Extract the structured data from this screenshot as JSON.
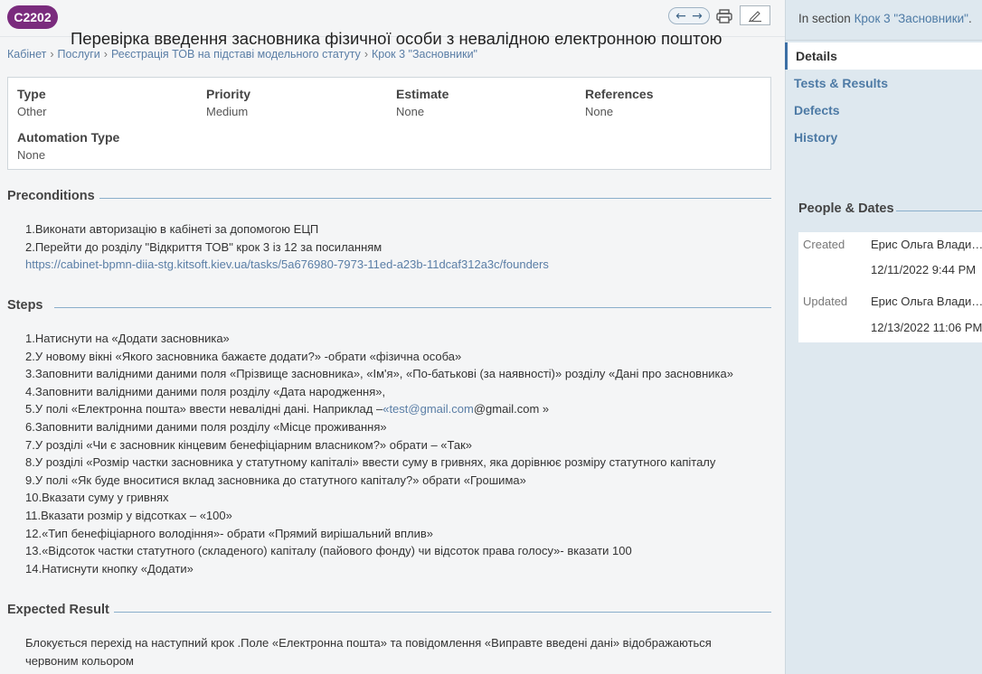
{
  "case": {
    "id": "C2202",
    "title": "Перевірка введення засновника фізичної особи з невалідною електронною поштою"
  },
  "breadcrumbs": [
    "Кабінет",
    "Послуги",
    "Реєстрація ТОВ на підставі модельного статуту",
    "Крок 3 \"Засновники\""
  ],
  "toolbar": {
    "prev_icon": "arrow-left-icon",
    "next_icon": "arrow-right-icon",
    "print_icon": "printer-icon",
    "edit_icon": "pencil-icon"
  },
  "fields": {
    "type": {
      "label": "Type",
      "value": "Other"
    },
    "priority": {
      "label": "Priority",
      "value": "Medium"
    },
    "estimate": {
      "label": "Estimate",
      "value": "None"
    },
    "references": {
      "label": "References",
      "value": "None"
    },
    "automation_type": {
      "label": "Automation Type",
      "value": "None"
    }
  },
  "preconditions": {
    "heading": "Preconditions",
    "lines": [
      "1.Виконати авторизацію в кабінеті за допомогою ЕЦП",
      "2.Перейти до розділу \"Відкриття ТОВ\" крок 3 із 12 за посиланням"
    ],
    "link": "https://cabinet-bpmn-diia-stg.kitsoft.kiev.ua/tasks/5a676980-7973-11ed-a23b-11dcaf312a3c/founders"
  },
  "steps": {
    "heading": "Steps",
    "lines": [
      "1.Натиснути на «Додати засновника»",
      "2.У новому вікні «Якого засновника бажаєте додати?» -обрати «фізична особа»",
      "3.Заповнити валідними даними поля «Прізвище засновника», «Ім'я», «По-батькові (за наявності)» розділу «Дані про засновника»",
      "4.Заповнити валідними даними поля розділу «Дата народження»,",
      "5.У полі «Електронна пошта» ввести невалідні дані. Наприклад –«test@gmail.com@gmail.com »",
      "6.Заповнити валідними даними поля розділу «Місце проживання»",
      "7.У розділі «Чи є засновник кінцевим бенефіціарним власником?» обрати – «Так»",
      "8.У розділі «Розмір частки засновника у статутному капіталі» ввести суму в гривнях, яка дорівнює розміру статутного капіталу",
      "9.У полі «Як буде вноситися вклад засновника до статутного капіталу?» обрати «Грошима»",
      "10.Вказати суму у гривнях",
      "11.Вказати розмір у відсотках – «100»",
      "12.«Тип бенефіціарного володіння»- обрати «Прямий вирішальний вплив»",
      "13.«Відсоток частки статутного (складеного) капіталу (пайового фонду) чи відсоток права голосу»- вказати 100",
      "14.Натиснути кнопку «Додати»"
    ],
    "step5": {
      "before": "5.У полі «Електронна пошта» ввести невалідні дані. Наприклад –",
      "link": "«test@gmail.com",
      "after": "@gmail.com »"
    }
  },
  "expected": {
    "heading": "Expected Result",
    "lines": [
      "Блокується перехід на наступний крок .Поле «Електронна пошта» та повідомлення «Виправте введені дані» відображаються",
      "червоним кольором"
    ]
  },
  "sidebar": {
    "section_prefix": "In section",
    "section_link": "Крок 3 \"Засновники\"",
    "section_suffix": ".",
    "nav": [
      "Details",
      "Tests & Results",
      "Defects",
      "History"
    ],
    "people_dates": {
      "heading": "People & Dates",
      "created_label": "Created",
      "created_by": "Ерис Ольга Влади…",
      "created_at": "12/11/2022 9:44 PM",
      "updated_label": "Updated",
      "updated_by": "Ерис Ольга Влади…",
      "updated_at": "12/13/2022 11:06 PM"
    }
  },
  "colors": {
    "badge": "#7a2b7d",
    "link": "#5a7ea6",
    "sidebar_bg": "#dee8ef",
    "section_rule": "#8aaecb"
  }
}
